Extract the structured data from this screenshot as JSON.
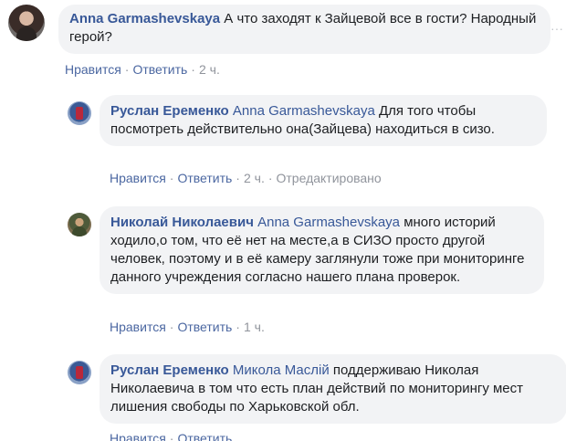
{
  "comments": [
    {
      "author": "Anna Garmashevskaya",
      "mention": "",
      "text": "А что заходят к Зайцевой все в гости? Народный герой?",
      "actions": {
        "like": "Нравится",
        "reply": "Ответить",
        "time": "2 ч.",
        "edited": ""
      }
    },
    {
      "author": "Руслан Еременко",
      "mention": "Anna Garmashevskaya",
      "text": "Для того чтобы посмотреть действительно она(Зайцева) находиться в сизо.",
      "actions": {
        "like": "Нравится",
        "reply": "Ответить",
        "time": "2 ч.",
        "edited": "Отредактировано"
      }
    },
    {
      "author": "Николай Николаевич",
      "mention": "Anna Garmashevskaya",
      "text": "много историй ходило,о том, что её нет на месте,а в СИЗО просто другой человек, поэтому и в её камеру заглянули тоже при мониторинге данного учреждения согласно нашего плана проверок.",
      "actions": {
        "like": "Нравится",
        "reply": "Ответить",
        "time": "1 ч.",
        "edited": ""
      }
    },
    {
      "author": "Руслан Еременко",
      "mention": "Микола Маслій",
      "text": "поддерживаю Николая Николаевича в том что есть план действий по мониторингу мест лишения свободы по Харьковской обл.",
      "actions": {
        "like": "Нравится",
        "reply": "Ответить",
        "time": "",
        "edited": ""
      }
    }
  ],
  "colors": {
    "link": "#385898",
    "action_link": "#4b67a1",
    "meta": "#90949c",
    "bubble": "#f2f3f5"
  },
  "icons": {
    "more": "more-options-icon"
  }
}
